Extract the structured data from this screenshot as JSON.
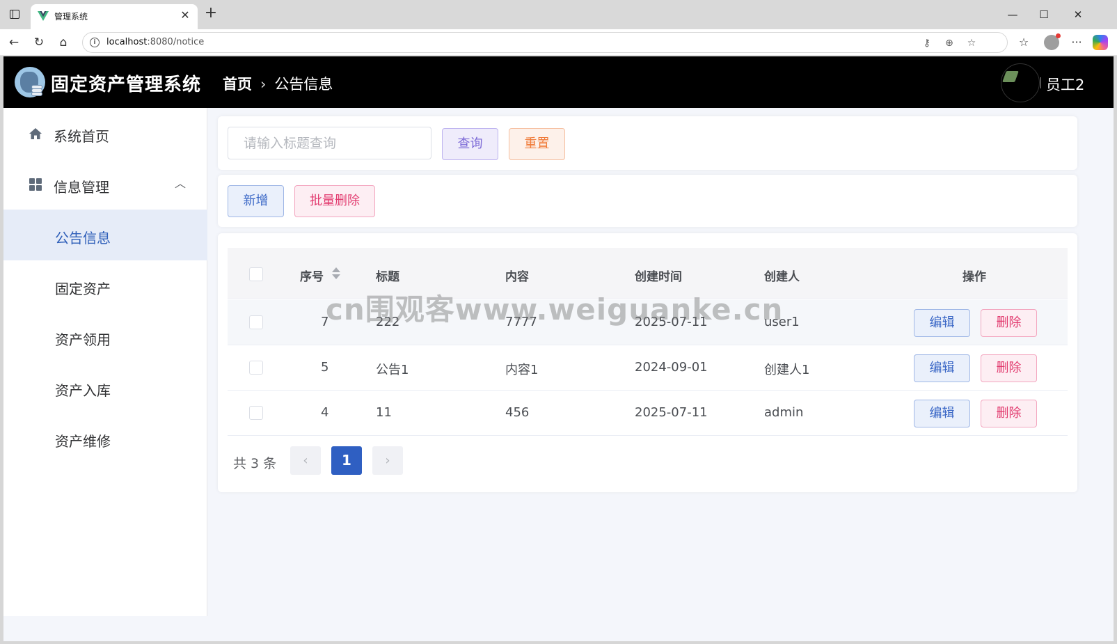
{
  "browser": {
    "tab_title": "管理系统",
    "url_host": "localhost",
    "url_rest": ":8080/notice"
  },
  "header": {
    "app_title": "固定资产管理系统",
    "breadcrumb_home": "首页",
    "breadcrumb_current": "公告信息",
    "username": "员工2"
  },
  "sidebar": {
    "home": "系统首页",
    "info_group": "信息管理",
    "items": [
      "公告信息",
      "固定资产",
      "资产领用",
      "资产入库",
      "资产维修"
    ]
  },
  "search": {
    "placeholder": "请输入标题查询",
    "value": "",
    "query_label": "查询",
    "reset_label": "重置"
  },
  "actions": {
    "add_label": "新增",
    "batch_delete_label": "批量删除"
  },
  "table": {
    "columns": [
      "序号",
      "标题",
      "内容",
      "创建时间",
      "创建人",
      "操作"
    ],
    "rows": [
      {
        "id": "7",
        "title": "222",
        "content": "7777",
        "created": "2025-07-11",
        "creator": "user1"
      },
      {
        "id": "5",
        "title": "公告1",
        "content": "内容1",
        "created": "2024-09-01",
        "creator": "创建人1"
      },
      {
        "id": "4",
        "title": "11",
        "content": "456",
        "created": "2025-07-11",
        "creator": "admin"
      }
    ],
    "edit_label": "编辑",
    "delete_label": "删除"
  },
  "pagination": {
    "total_text": "共 3 条",
    "current_page": "1"
  },
  "watermark": "cn围观客www.weiguanke.cn",
  "colors": {
    "header_bg": "#000000",
    "active_menu_bg": "#e6ecf8",
    "primary": "#2f5fc2",
    "danger": "#e23b6f"
  }
}
